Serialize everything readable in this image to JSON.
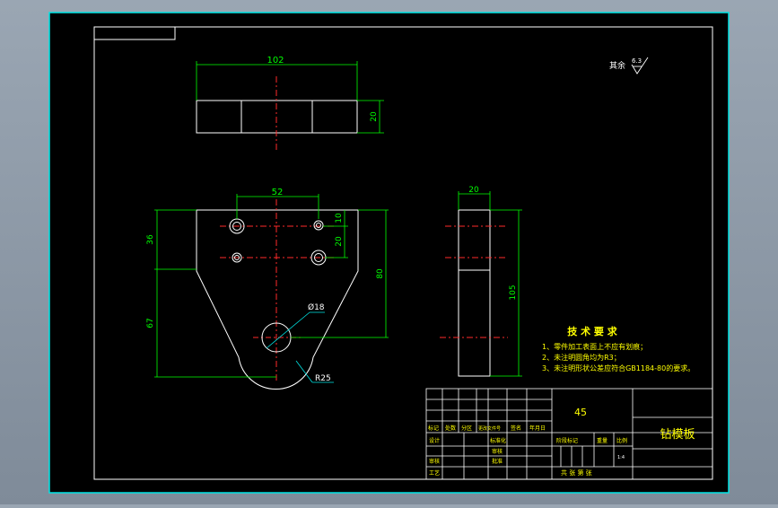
{
  "dimensions": {
    "top_width": "102",
    "top_height": "20",
    "hole_spacing": "52",
    "hole_top_offset": "10",
    "hole_vertical_spacing": "20",
    "left_upper_height": "36",
    "left_lower_height": "67",
    "right_height": "80",
    "side_width": "20",
    "side_height": "105",
    "center_hole_dia": "Ø18",
    "bottom_radius": "R25"
  },
  "surface_finish": {
    "label": "其余",
    "value": "6.3"
  },
  "technical_requirements": {
    "title": "技 术 要 求",
    "items": [
      "1、零件加工表面上不应有划痕；",
      "2、未注明圆角均为R3；",
      "3、未注明形状公差应符合GB1184-80的要求。"
    ]
  },
  "title_block": {
    "material": "45",
    "part_name": "钻模板",
    "header_cells": [
      "标记",
      "处数",
      "分区",
      "更改文件号",
      "签名",
      "年月日"
    ],
    "left_labels": [
      "设计",
      "审核",
      "工艺"
    ],
    "mid_labels": [
      "标准化",
      "审核",
      "批准"
    ],
    "stage_labels": [
      "阶段标记",
      "重量",
      "比例"
    ],
    "scale": "1:4",
    "sheet_text": "共 张 第 张"
  },
  "colors": {
    "outline": "#ffffff",
    "dimension": "#00ff00",
    "centerline": "#ff2a2a",
    "annotation": "#ffff00",
    "border": "#00ffff",
    "paper": "#000000"
  }
}
